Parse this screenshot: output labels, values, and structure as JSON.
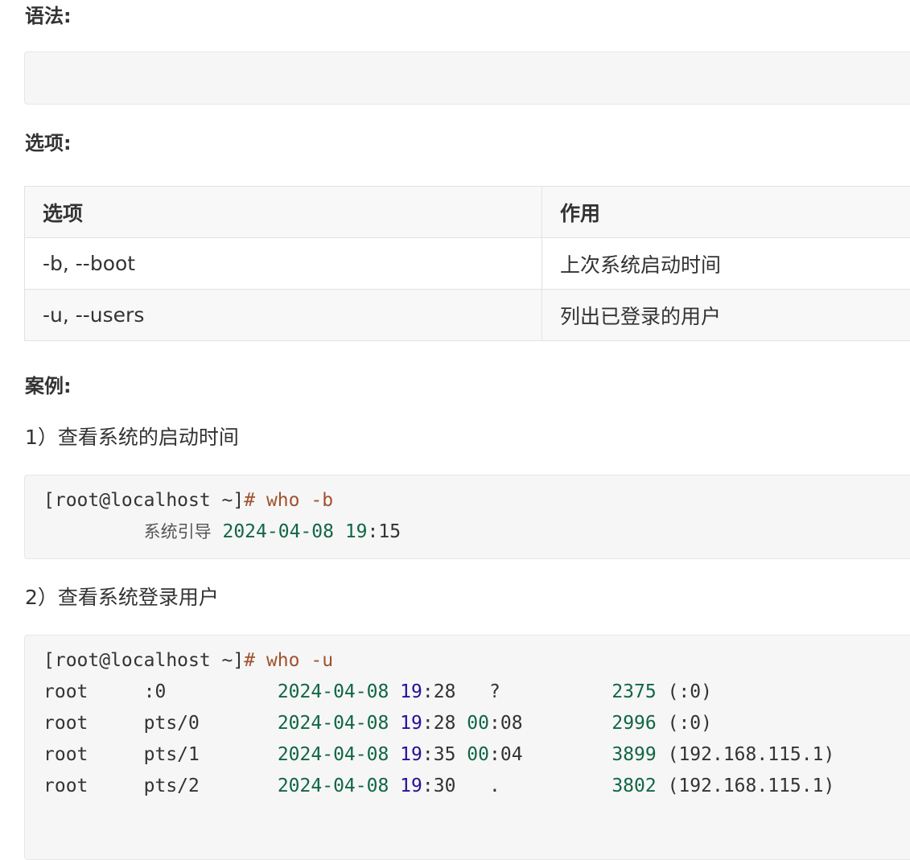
{
  "sections": {
    "syntax_heading": "语法:",
    "options_heading": "选项:",
    "examples_heading": "案例:"
  },
  "options_table": {
    "headers": [
      "选项",
      "作用"
    ],
    "rows": [
      [
        "-b, --boot",
        "上次系统启动时间"
      ],
      [
        "-u, --users",
        "列出已登录的用户"
      ]
    ]
  },
  "examples": [
    {
      "title": "1）查看系统的启动时间",
      "prompt": "[root@localhost ~]",
      "hash": "#",
      "command": " who -b",
      "output": [
        {
          "label": "系统引导",
          "date": "2024-04-08",
          "hour": "19",
          "min": "15"
        }
      ]
    },
    {
      "title": "2）查看系统登录用户",
      "prompt": "[root@localhost ~]",
      "hash": "#",
      "command": " who -u",
      "rows": [
        {
          "user": "root",
          "line": ":0",
          "date": "2024-04-08",
          "hour": "19",
          "min": "28",
          "idle_a": "?",
          "idle_b": "",
          "pid": "2375",
          "host": "(:0)"
        },
        {
          "user": "root",
          "line": "pts/0",
          "date": "2024-04-08",
          "hour": "19",
          "min": "28",
          "idle_a": "00",
          "idle_b": "08",
          "pid": "2996",
          "host": "(:0)"
        },
        {
          "user": "root",
          "line": "pts/1",
          "date": "2024-04-08",
          "hour": "19",
          "min": "35",
          "idle_a": "00",
          "idle_b": "04",
          "pid": "3899",
          "host": "(192.168.115.1)"
        },
        {
          "user": "root",
          "line": "pts/2",
          "date": "2024-04-08",
          "hour": "19",
          "min": "30",
          "idle_a": ".",
          "idle_b": "",
          "pid": "3802",
          "host": "(192.168.115.1)"
        }
      ]
    }
  ]
}
